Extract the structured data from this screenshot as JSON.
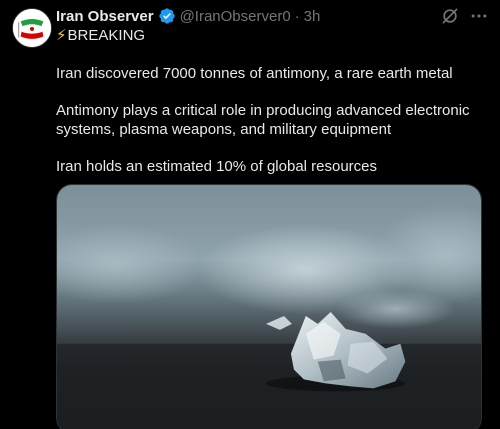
{
  "author": {
    "display_name": "Iran Observer",
    "handle": "@IranObserver0",
    "separator": "·",
    "timestamp": "3h",
    "verified": true
  },
  "icons": {
    "verified": "verified-badge-icon",
    "grok": "grok-icon",
    "more": "more-icon"
  },
  "tweet": {
    "breaking_emoji": "⚡",
    "breaking_text": "BREAKING",
    "paragraph_1": "Iran discovered 7000 tonnes of antimony, a rare earth metal",
    "paragraph_2_line_1": "Antimony plays a critical role in producing advanced electronic",
    "paragraph_2_line_2": "systems, plasma weapons, and military equipment",
    "paragraph_3": "Iran holds an estimated 10% of global resources"
  },
  "colors": {
    "background": "#000000",
    "text_primary": "#e7e9ea",
    "text_secondary": "#71767b",
    "verified_blue": "#1d9bf0",
    "flag_green": "#239f40",
    "flag_red": "#da0000"
  }
}
